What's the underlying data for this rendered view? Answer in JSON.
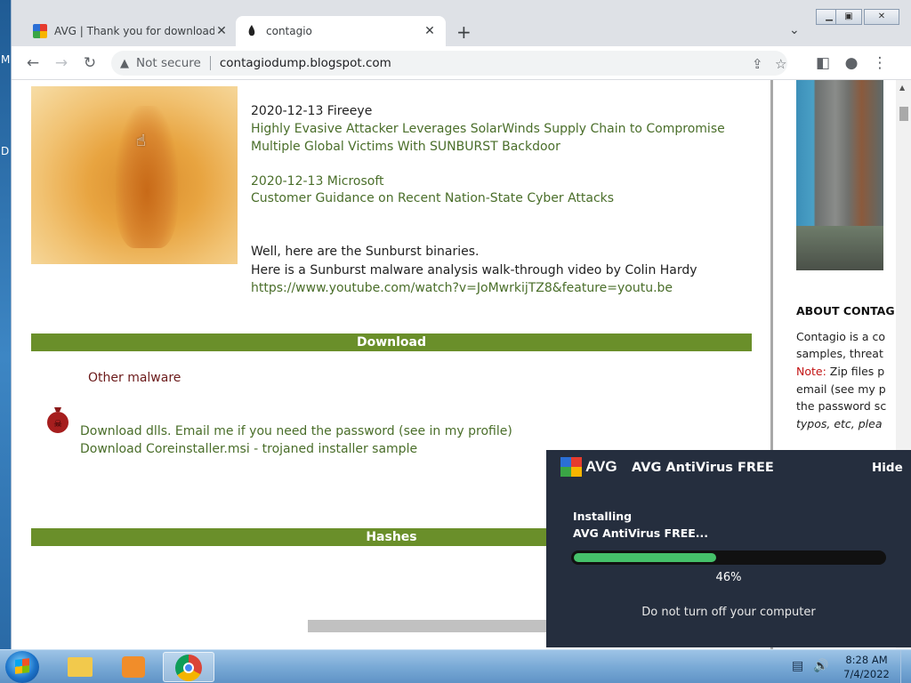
{
  "desktop": {
    "side_letters": [
      "M",
      "D"
    ]
  },
  "browser": {
    "tabs": [
      {
        "label": "AVG | Thank you for downloading",
        "favicon": "avg-icon",
        "active": false
      },
      {
        "label": "contagio",
        "favicon": "contagio-icon",
        "active": true
      }
    ],
    "new_tab_label": "+",
    "address": {
      "security_label": "Not secure",
      "url": "contagiodump.blogspot.com"
    }
  },
  "page": {
    "entries": [
      {
        "title": "2020-12-13 Fireeye",
        "link_line1": "Highly Evasive Attacker Leverages SolarWinds Supply Chain to Compromise",
        "link_line2": "Multiple Global Victims With SUNBURST Backdoor"
      },
      {
        "title": "2020-12-13 Microsoft",
        "link_line1": "Customer Guidance on Recent Nation-State Cyber Attacks"
      }
    ],
    "intro_line1": "Well, here are the Sunburst binaries.",
    "intro_line2": "Here is a Sunburst malware analysis walk-through video by Colin Hardy",
    "video_link": "https://www.youtube.com/watch?v=JoMwrkijTZ8&feature=youtu.be",
    "download_heading": "Download",
    "other_malware": "Other malware",
    "download_line1": "Download dlls. Email me if you need the password (see in my profile)",
    "download_line2": "Download Coreinstaller.msi - trojaned installer sample",
    "hashes_heading": "Hashes"
  },
  "sidebar": {
    "heading": "ABOUT CONTAG",
    "lines": [
      "Contagio is a co",
      "samples, threat"
    ],
    "note_label": "Note:",
    "note_text": " Zip files p",
    "lines2": [
      "email (see my p",
      "the password sc",
      "typos, etc, plea"
    ]
  },
  "avg_popup": {
    "logo_text": "AVG",
    "title": "AVG AntiVirus FREE",
    "hide_label": "Hide",
    "status_line1": "Installing",
    "status_line2": "AVG AntiVirus FREE...",
    "progress_percent": 46,
    "progress_label": "46%",
    "message": "Do not turn off your computer"
  },
  "taskbar": {
    "time": "8:28 AM",
    "date": "7/4/2022"
  }
}
